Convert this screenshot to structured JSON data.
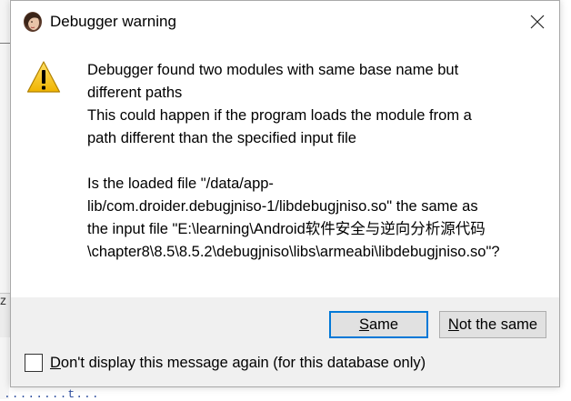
{
  "dialog": {
    "title": "Debugger warning",
    "message_lines": [
      "Debugger found two modules with same base name but",
      "different paths",
      "This could happen if the program loads the module from a",
      "path different than the specified input file",
      "",
      "Is the loaded file \"/data/app-",
      "lib/com.droider.debugjniso-1/libdebugjniso.so\" the same as",
      "the input file \"E:\\learning\\Android软件安全与逆向分析源代码",
      "\\chapter8\\8.5\\8.5.2\\debugjniso\\libs\\armeabi\\libdebugjniso.so\"?"
    ],
    "buttons": {
      "same_prefix": "",
      "same_mnemonic": "S",
      "same_rest": "ame",
      "not_same_prefix": "",
      "not_same_mnemonic": "N",
      "not_same_rest": "ot the same"
    },
    "checkbox": {
      "label_mnemonic": "D",
      "label_rest": "on't display this message again (for this database only)",
      "checked": false
    }
  },
  "background": {
    "text_fragment": "z",
    "dotted_fragment": "........t..."
  },
  "icons": {
    "app": "ida-app-icon",
    "close": "close-icon",
    "warning": "warning-icon"
  },
  "colors": {
    "default_button_border": "#0078d7",
    "warning_yellow": "#f5c400",
    "dialog_bg": "#f0f0f0"
  }
}
